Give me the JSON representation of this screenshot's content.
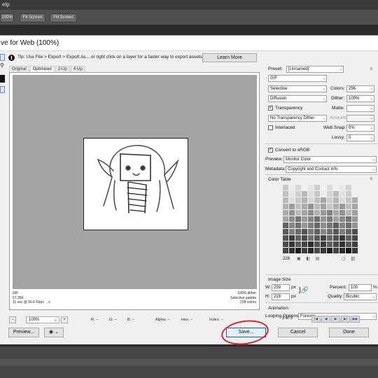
{
  "app": {
    "menu_fragment": "elp",
    "zoom_btn": "100%",
    "fit_btn": "Fit Screen",
    "fill_btn": "Fill Screen"
  },
  "dialog": {
    "title": "ve for Web (100%)",
    "tip": "Tip: Use File > Export > Export As... or right click on a layer for a faster way to export assets",
    "learn_more": "Learn More",
    "tabs": [
      "Original",
      "Optimized",
      "2-Up",
      "4-Up"
    ]
  },
  "preview": {
    "info_left": [
      "GIF",
      "57.35K",
      "11 sec @ 56.6 Kbps →≡"
    ],
    "info_right": [
      "100% dither",
      "Selective palette",
      "228 colors"
    ]
  },
  "zoom": {
    "value": "100%",
    "readouts": [
      "R: --",
      "G: --",
      "B: --",
      "Alpha: --",
      "Hex: --",
      "Index: --"
    ]
  },
  "settings": {
    "preset_label": "Preset:",
    "preset_value": "[Unnamed]",
    "format": "GIF",
    "reduction": "Selective",
    "colors_label": "Colors:",
    "colors_value": "256",
    "dither_algo": "Diffusion",
    "dither_label": "Dither:",
    "dither_value": "100%",
    "transparency_label": "Transparency",
    "matte_label": "Matte:",
    "trans_dither": "No Transparency Dither",
    "amount_label": "Amount:",
    "interlaced_label": "Interlaced",
    "websnap_label": "Web Snap:",
    "websnap_value": "0%",
    "lossy_label": "Lossy:",
    "lossy_value": "0",
    "srgb_label": "Convert to sRGB",
    "preview_label": "Preview:",
    "preview_value": "Monitor Color",
    "metadata_label": "Metadata:",
    "metadata_value": "Copyright and Contact Info"
  },
  "color_table": {
    "title": "Color Table",
    "count": "228"
  },
  "image_size": {
    "title": "Image Size",
    "w_label": "W:",
    "w_value": "259",
    "h_label": "H:",
    "h_value": "228",
    "unit": "px",
    "percent_label": "Percent:",
    "percent_value": "100",
    "percent_unit": "%",
    "quality_label": "Quality:",
    "quality_value": "Bicubic"
  },
  "animation": {
    "title": "Animation",
    "looping_label": "Looping Options:",
    "looping_value": "Forever",
    "frame_counter": "3 of 5"
  },
  "buttons": {
    "preview": "Preview...",
    "save": "Save...",
    "cancel": "Cancel",
    "done": "Done"
  }
}
